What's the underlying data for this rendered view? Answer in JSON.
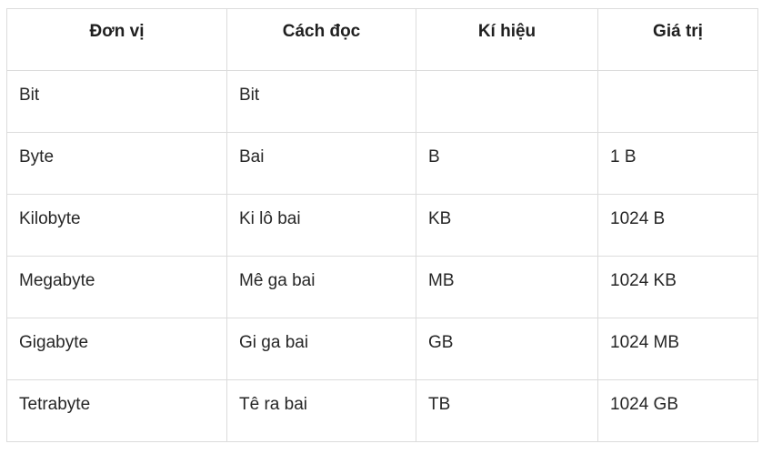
{
  "table": {
    "headers": [
      "Đơn vị",
      "Cách đọc",
      "Kí hiệu",
      "Giá trị"
    ],
    "rows": [
      [
        "Bit",
        "Bit",
        "",
        ""
      ],
      [
        "Byte",
        "Bai",
        "B",
        "1 B"
      ],
      [
        "Kilobyte",
        "Ki lô bai",
        "KB",
        "1024 B"
      ],
      [
        "Megabyte",
        "Mê ga bai",
        "MB",
        "1024 KB"
      ],
      [
        "Gigabyte",
        "Gi ga bai",
        "GB",
        "1024 MB"
      ],
      [
        "Tetrabyte",
        "Tê ra bai",
        "TB",
        "1024 GB"
      ]
    ]
  }
}
